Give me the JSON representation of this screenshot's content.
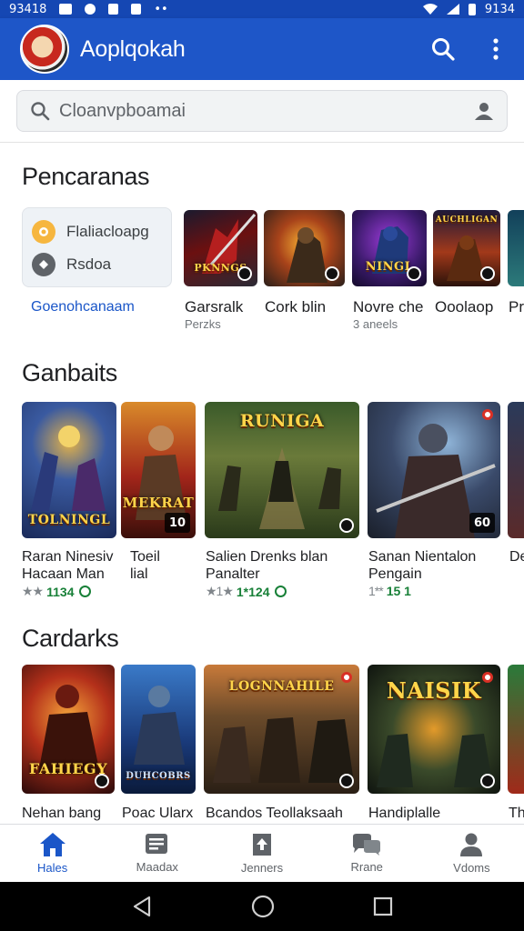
{
  "status_bar": {
    "time_left": "93418",
    "time_right": "9134"
  },
  "app_bar": {
    "title": "Aoplqokah",
    "search_icon": "search-icon",
    "more_icon": "more-vert-icon"
  },
  "search": {
    "placeholder": "Cloanvpboamai"
  },
  "sections": [
    {
      "title": "Pencaranas",
      "categories": [
        {
          "label": "Flaliacloapg",
          "icon": "category-icon",
          "color": "#f6b63f"
        },
        {
          "label": "Rsdoa",
          "icon": "category-icon",
          "color": "#5f6368"
        }
      ],
      "link": "Goenohcanaam",
      "items": [
        {
          "name": "Garsralk",
          "sub": "Perzks",
          "wordmark": "PKNNGS"
        },
        {
          "name": "Cork blin",
          "sub": "",
          "wordmark": ""
        },
        {
          "name": "Novre che",
          "sub": "3 aneels",
          "wordmark": "NINGL"
        },
        {
          "name": "Ooolaop",
          "sub": "",
          "wordmark": "AUCHLIGAN"
        },
        {
          "name": "Pr",
          "sub": "",
          "wordmark": ""
        }
      ]
    },
    {
      "title": "Ganbaits",
      "items": [
        {
          "name": "Raran Ninesiv",
          "name2": "Hacaan Man",
          "wordmark": "TOLNINGL",
          "rating": "1134",
          "stars": "★★"
        },
        {
          "name": "Toeil",
          "name2": "lial",
          "wordmark": "MEKRAT",
          "badge": "10"
        },
        {
          "name": "Salien Drenks blan",
          "name2": "Panalter",
          "wordmark": "RUNIGA",
          "rating": "1*124",
          "stars": "★1★"
        },
        {
          "name": "Sanan Nientalon",
          "name2": "Pengain",
          "wordmark": "",
          "rating": "15 1",
          "stars": "1**",
          "badge": "60"
        },
        {
          "name": "De",
          "name2": "",
          "wordmark": ""
        }
      ]
    },
    {
      "title": "Cardarks",
      "items": [
        {
          "name": "Nehan bang",
          "wordmark": "FAHIEGY"
        },
        {
          "name": "Poac Ularx",
          "wordmark": "DUHCOBRS"
        },
        {
          "name": "Bcandos Teollaksaah",
          "wordmark": "LOGNNAHILE"
        },
        {
          "name": "Handiplalle",
          "wordmark": "NAISIK"
        },
        {
          "name": "Th",
          "wordmark": ""
        }
      ]
    }
  ],
  "bottom_nav": [
    {
      "label": "Hales",
      "icon": "home-icon",
      "active": true
    },
    {
      "label": "Maadax",
      "icon": "news-icon",
      "active": false
    },
    {
      "label": "Jenners",
      "icon": "download-icon",
      "active": false
    },
    {
      "label": "Rrane",
      "icon": "chat-icon",
      "active": false
    },
    {
      "label": "Vdoms",
      "icon": "person-icon",
      "active": false
    }
  ],
  "colors": {
    "app_bar": "#1e56c8",
    "status_bar": "#1547b3",
    "accent": "#1a56c8",
    "rating_green": "#188038"
  }
}
